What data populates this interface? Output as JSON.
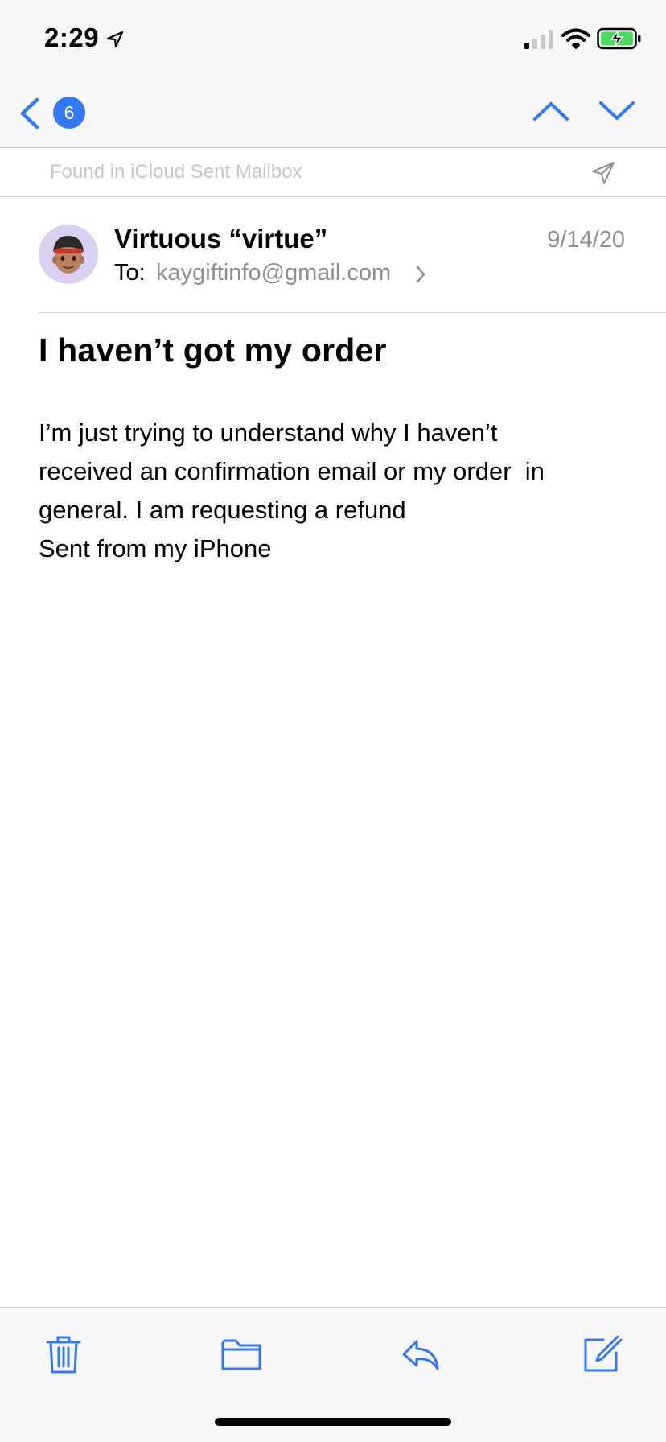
{
  "status_bar": {
    "time": "2:29",
    "icons": [
      "location-arrow-icon",
      "cellular-signal-icon",
      "wifi-icon",
      "battery-charging-icon"
    ]
  },
  "nav": {
    "back_count": "6",
    "icons": [
      "chevron-left-icon",
      "chevron-up-icon",
      "chevron-down-icon"
    ]
  },
  "found_in": {
    "text": "Found in iCloud Sent Mailbox",
    "icon": "paper-plane-icon"
  },
  "message": {
    "sender": "Virtuous “virtue”",
    "to_label": "To:",
    "to_address": "kaygiftinfo@gmail.com",
    "date": "9/14/20",
    "subject": "I haven’t got my order",
    "body_lines": [
      "I’m just trying to understand why I haven’t",
      "received an confirmation email or my order  in",
      "general. I am requesting a refund",
      "Sent from my iPhone"
    ]
  },
  "toolbar": {
    "icons": [
      "trash-icon",
      "folder-icon",
      "reply-icon",
      "compose-icon"
    ]
  },
  "colors": {
    "accent": "#3478f6",
    "secondary_text": "#8e8e93",
    "chrome_bg": "#f7f7f8",
    "avatar_bg": "#dad0f2"
  }
}
